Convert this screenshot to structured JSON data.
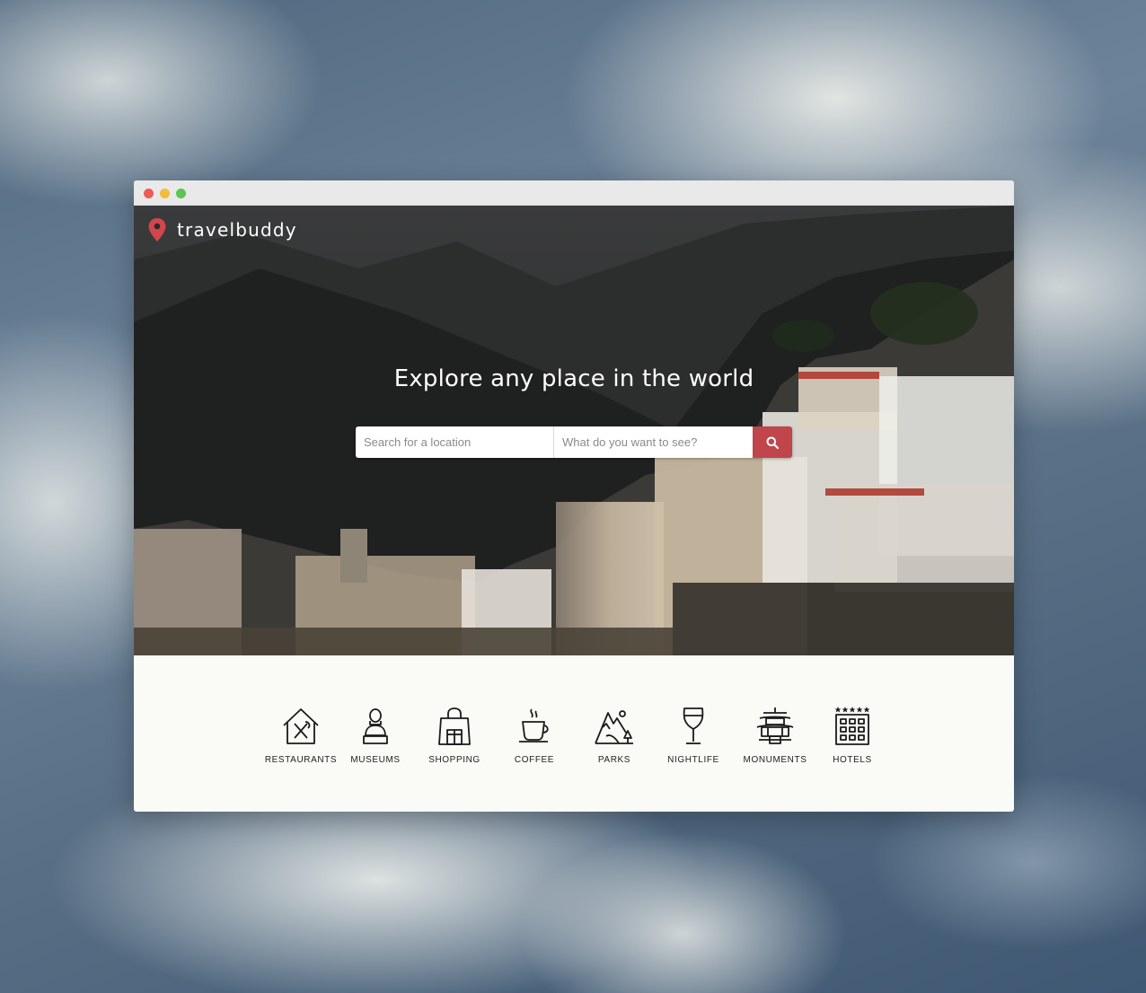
{
  "app": {
    "brand": "travelbuddy"
  },
  "hero": {
    "headline": "Explore any place in the world"
  },
  "search": {
    "location_placeholder": "Search for a location",
    "what_placeholder": "What do you want to see?",
    "location_value": "",
    "what_value": ""
  },
  "categories": [
    {
      "label": "RESTAURANTS",
      "icon": "restaurant-icon"
    },
    {
      "label": "MUSEUMS",
      "icon": "museum-bust-icon"
    },
    {
      "label": "SHOPPING",
      "icon": "shopping-bag-icon"
    },
    {
      "label": "COFFEE",
      "icon": "coffee-cup-icon"
    },
    {
      "label": "PARKS",
      "icon": "park-icon"
    },
    {
      "label": "NIGHTLIFE",
      "icon": "wine-glass-icon"
    },
    {
      "label": "MONUMENTS",
      "icon": "pagoda-icon"
    },
    {
      "label": "HOTELS",
      "icon": "hotel-building-icon"
    }
  ],
  "colors": {
    "accent": "#c0464c",
    "page_background": "#fafaf6",
    "titlebar": "#e9e9e9"
  }
}
